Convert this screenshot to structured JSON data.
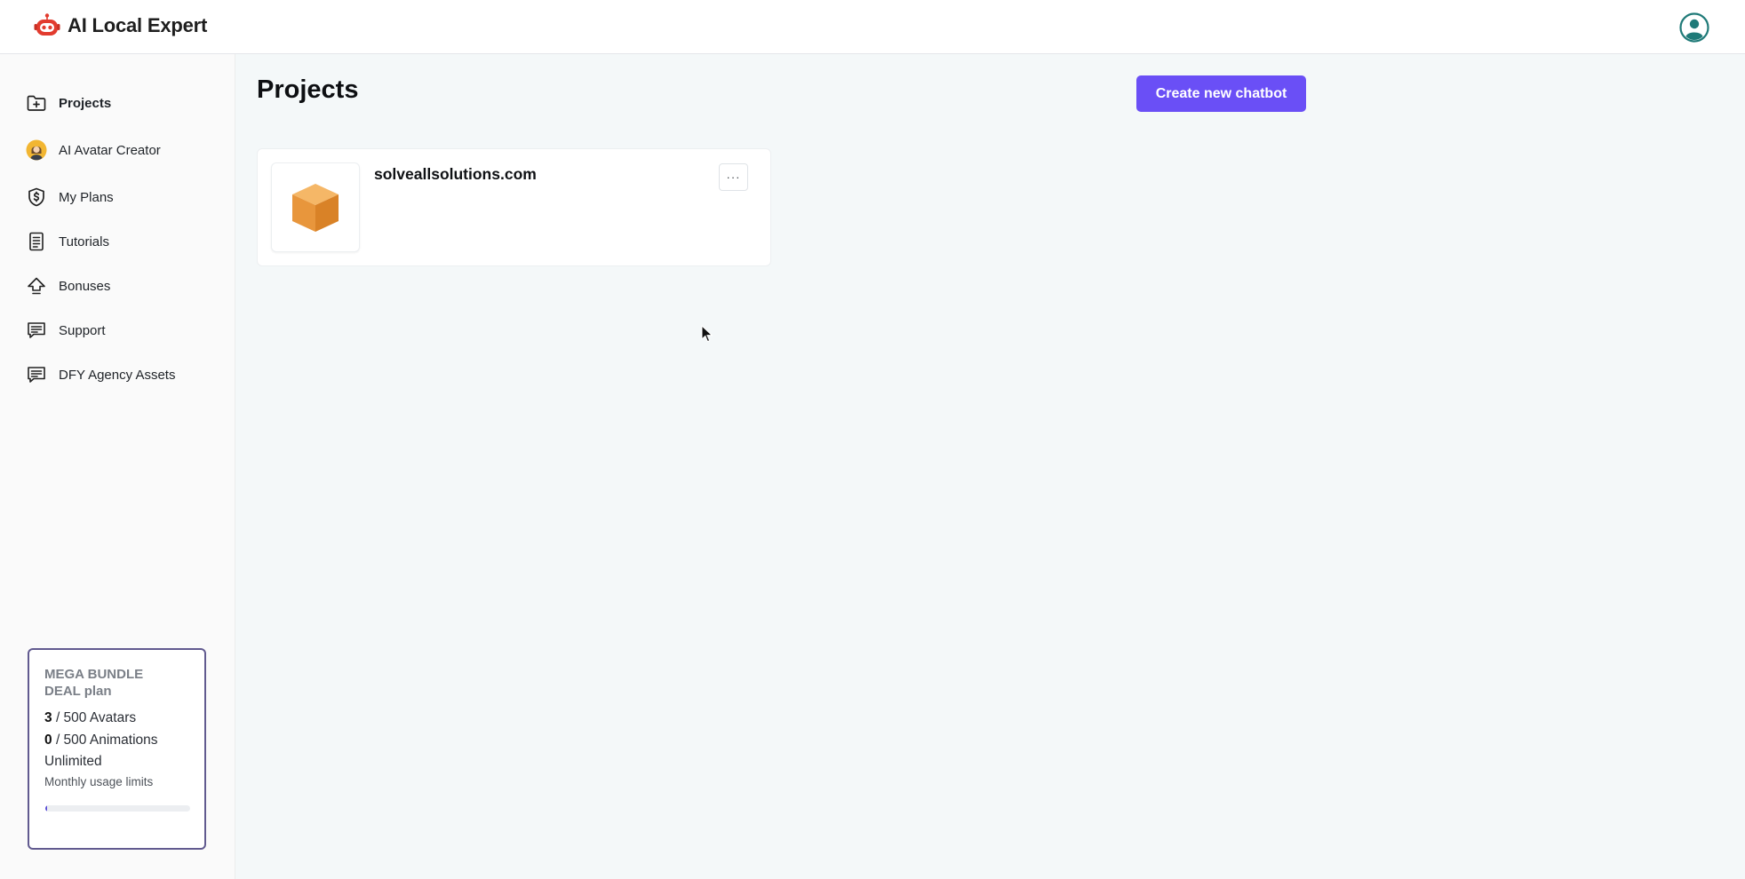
{
  "header": {
    "app_name": "AI Local Expert",
    "logo_icon": "robot-icon",
    "user_icon": "user-account-icon",
    "brand_color": "#e23b2e"
  },
  "sidebar": {
    "items": [
      {
        "label": "Projects",
        "icon": "folder-plus-icon",
        "active": true
      },
      {
        "label": "AI Avatar Creator",
        "icon": "avatar-icon",
        "active": false
      },
      {
        "label": "My Plans",
        "icon": "shield-dollar-icon",
        "active": false
      },
      {
        "label": "Tutorials",
        "icon": "document-icon",
        "active": false
      },
      {
        "label": "Bonuses",
        "icon": "upload-arrow-icon",
        "active": false
      },
      {
        "label": "Support",
        "icon": "chat-icon",
        "active": false
      },
      {
        "label": "DFY Agency Assets",
        "icon": "chat-icon",
        "active": false
      }
    ],
    "plan": {
      "title": "MEGA BUNDLE DEAL plan",
      "avatars_used": "3",
      "avatars_total": "/ 500 Avatars",
      "animations_used": "0",
      "animations_total": "/ 500 Animations",
      "unlimited": "Unlimited",
      "subtitle": "Monthly usage limits",
      "progress_fraction": 0.006,
      "border_color": "#615a8f",
      "progress_color": "#5b4fd6"
    }
  },
  "main": {
    "title": "Projects",
    "create_button": "Create new chatbot",
    "accent_color": "#6a4ff6",
    "projects": [
      {
        "name": "solveallsolutions.com",
        "thumbnail_icon": "box-icon",
        "menu_label": "···"
      }
    ]
  }
}
